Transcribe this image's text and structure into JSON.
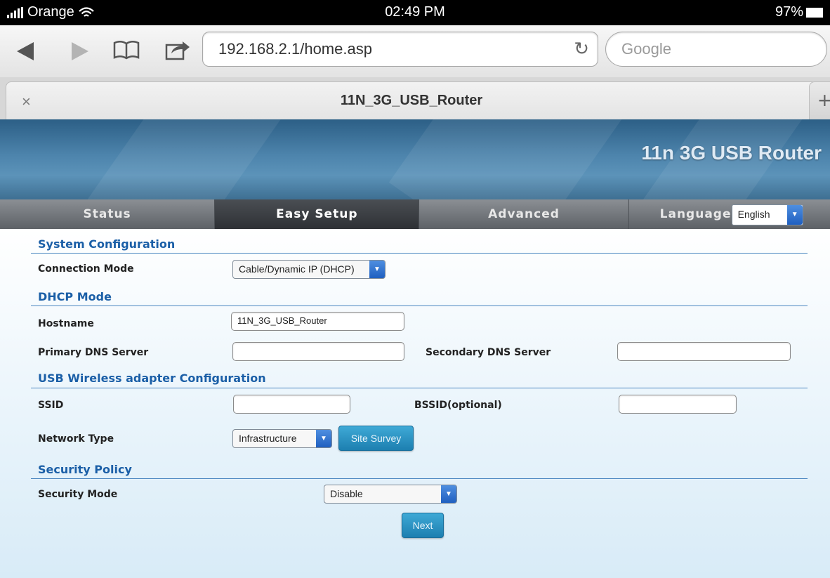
{
  "status_bar": {
    "carrier": "Orange",
    "time": "02:49 PM",
    "battery": "97%",
    "icons": [
      "signal-icon",
      "wifi-icon",
      "battery-icon"
    ]
  },
  "browser": {
    "url": "192.168.2.1/home.asp",
    "search_placeholder": "Google",
    "tab_title": "11N_3G_USB_Router",
    "icons": [
      "back-icon",
      "forward-icon",
      "bookmarks-icon",
      "share-icon",
      "reload-icon",
      "close-tab-icon",
      "new-tab-icon"
    ]
  },
  "router": {
    "brand": "11n 3G USB Router",
    "nav": {
      "status": "Status",
      "easy_setup": "Easy Setup",
      "advanced": "Advanced",
      "language_label": "Language",
      "language_value": "English"
    },
    "active_tab": "Easy Setup"
  },
  "form": {
    "system_configuration": {
      "heading": "System Configuration",
      "connection_mode_label": "Connection Mode",
      "connection_mode_value": "Cable/Dynamic IP (DHCP)"
    },
    "dhcp_mode": {
      "heading": "DHCP Mode",
      "hostname_label": "Hostname",
      "hostname_value": "11N_3G_USB_Router",
      "primary_dns_label": "Primary DNS Server",
      "primary_dns_value": "",
      "secondary_dns_label": "Secondary DNS Server",
      "secondary_dns_value": ""
    },
    "usb_wireless": {
      "heading": "USB Wireless adapter Configuration",
      "ssid_label": "SSID",
      "ssid_value": "",
      "bssid_label": "BSSID(optional)",
      "bssid_value": "",
      "network_type_label": "Network Type",
      "network_type_value": "Infrastructure",
      "site_survey_label": "Site Survey"
    },
    "security_policy": {
      "heading": "Security Policy",
      "security_mode_label": "Security Mode",
      "security_mode_value": "Disable"
    },
    "next_label": "Next"
  },
  "colors": {
    "section_heading": "#1b5fa7",
    "button": "#2793c4",
    "nav_active": "#2e3135",
    "header": "#4d84ac"
  }
}
